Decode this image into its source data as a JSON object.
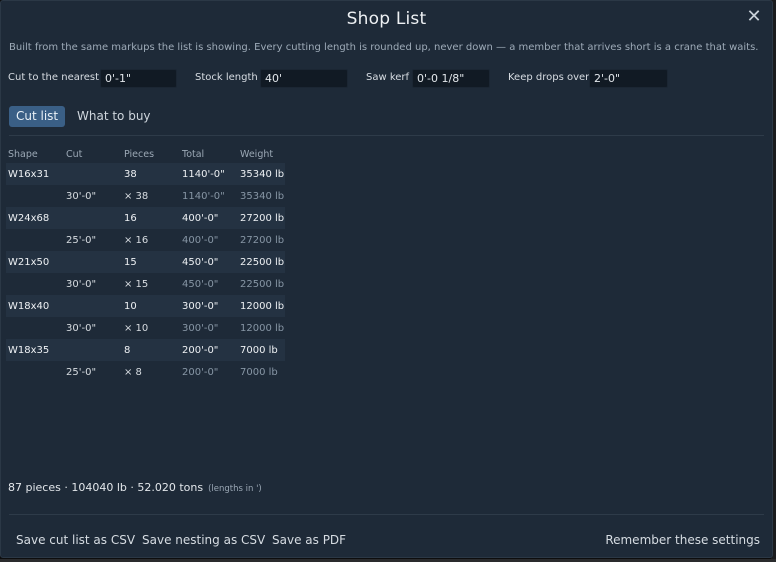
{
  "dialog": {
    "title": "Shop List",
    "close_glyph": "✕",
    "note": "Built from the same markups the list is showing. Every cutting length is rounded up, never down — a member that arrives short is a crane that waits."
  },
  "settings": {
    "round_label": "Cut to the nearest",
    "round_value": "0'-1\"",
    "stock_label": "Stock length",
    "stock_value": "40'",
    "kerf_label": "Saw kerf",
    "kerf_value": "0'-0 1/8\"",
    "drops_label": "Keep drops over",
    "drops_value": "2'-0\""
  },
  "tabs": {
    "cut_list": "Cut list",
    "what_to_buy": "What to buy"
  },
  "table": {
    "headers": {
      "shape": "Shape",
      "cut": "Cut",
      "pieces": "Pieces",
      "total": "Total",
      "weight": "Weight"
    },
    "groups": [
      {
        "shape": "W16x31",
        "pieces": "38",
        "total": "1140'-0\"",
        "weight": "35340 lb",
        "cut": "30'-0\"",
        "cut_pieces": "× 38",
        "cut_total": "1140'-0\"",
        "cut_weight": "35340 lb"
      },
      {
        "shape": "W24x68",
        "pieces": "16",
        "total": "400'-0\"",
        "weight": "27200 lb",
        "cut": "25'-0\"",
        "cut_pieces": "× 16",
        "cut_total": "400'-0\"",
        "cut_weight": "27200 lb"
      },
      {
        "shape": "W21x50",
        "pieces": "15",
        "total": "450'-0\"",
        "weight": "22500 lb",
        "cut": "30'-0\"",
        "cut_pieces": "× 15",
        "cut_total": "450'-0\"",
        "cut_weight": "22500 lb"
      },
      {
        "shape": "W18x40",
        "pieces": "10",
        "total": "300'-0\"",
        "weight": "12000 lb",
        "cut": "30'-0\"",
        "cut_pieces": "× 10",
        "cut_total": "300'-0\"",
        "cut_weight": "12000 lb"
      },
      {
        "shape": "W18x35",
        "pieces": "8",
        "total": "200'-0\"",
        "weight": "7000 lb",
        "cut": "25'-0\"",
        "cut_pieces": "× 8",
        "cut_total": "200'-0\"",
        "cut_weight": "7000 lb"
      }
    ]
  },
  "summary": {
    "text": "87 pieces · 104040 lb · 52.020 tons",
    "hint": "(lengths in ')"
  },
  "footer": {
    "save_csv": "Save cut list as CSV",
    "save_nesting": "Save nesting as CSV",
    "save_pdf": "Save as PDF",
    "remember": "Remember these settings"
  },
  "colors": {
    "dialog_bg": "#1e2a38",
    "accent": "#3a5f86",
    "group_row": "#243242"
  }
}
